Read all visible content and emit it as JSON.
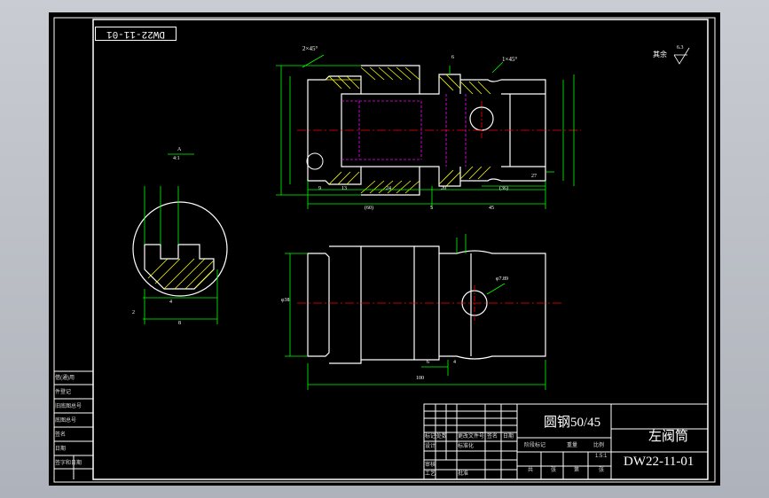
{
  "drawing_number": "DW22-11-01",
  "drawing_number_rotated": "DW22-11-01",
  "part_name": "左阀筒",
  "material": "圆钢50/45",
  "roughness_note": "其余",
  "roughness_value": "6.3",
  "section_label": "A",
  "section_scale": "4:1",
  "chamfer_left": "2×45°",
  "chamfer_right": "1×45°",
  "scale_value": "1.5:1",
  "title_block_cells": [
    "标记",
    "处数",
    "更改文件号",
    "签名",
    "日期",
    "设计",
    "标准化",
    "审核",
    "工艺",
    "批准",
    "阶段标记",
    "重量",
    "比例",
    "共",
    "张",
    "第",
    "张"
  ],
  "left_table": [
    "借(通)用",
    "件登记",
    "旧底图总号",
    "底图总号",
    "签名",
    "日期",
    "签字和日期"
  ],
  "dimensions_top": [
    "9",
    "13",
    "24",
    "20",
    "(36)",
    "27",
    "(60)",
    "5",
    "45",
    "6"
  ],
  "dimensions_vertical": [
    "φ40",
    "φ46",
    "φ49",
    "φ38",
    "φ32",
    "φ31",
    "φ38",
    "φ35",
    "M36×1.5",
    "φ41.5"
  ],
  "dimensions_bottom": [
    "100",
    "6",
    "4",
    "φ38",
    "φ7.89",
    "φ5",
    "9.5"
  ],
  "detail_dims": [
    "3.7",
    "15",
    "2",
    "4",
    "8"
  ],
  "colors": {
    "background": "#000000",
    "outline": "#ffffff",
    "dimension": "#00ff00",
    "centerline": "#ff0000",
    "hidden": "#ff00ff",
    "hatch": "#ffff00",
    "window": "#bfc3ca"
  }
}
